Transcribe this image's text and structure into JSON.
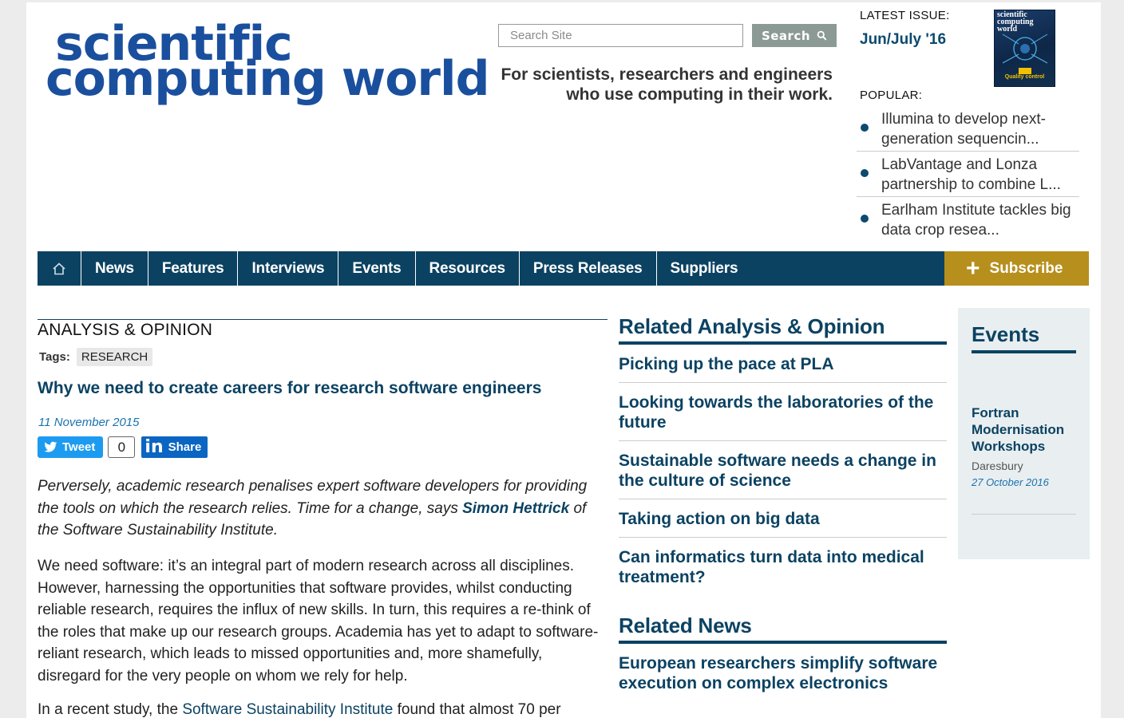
{
  "logo": {
    "line1": "scientific",
    "line2": "computing world"
  },
  "search": {
    "placeholder": "Search Site",
    "button_label": "Search"
  },
  "tagline": {
    "line1": "For scientists, researchers and engineers",
    "line2": "who use computing in their work."
  },
  "latest_issue": {
    "label": "LATEST ISSUE:",
    "issue": "Jun/July '16",
    "cover_title": "scientific computing world",
    "cover_caption": "Quality control"
  },
  "popular": {
    "label": "POPULAR:",
    "items": [
      {
        "text": "Illumina to develop next-generation sequencin..."
      },
      {
        "text": "LabVantage and Lonza partnership to combine L..."
      },
      {
        "text": "Earlham Institute tackles big data crop resea..."
      }
    ]
  },
  "nav": {
    "items": [
      "News",
      "Features",
      "Interviews",
      "Events",
      "Resources",
      "Press Releases",
      "Suppliers"
    ],
    "subscribe_label": "Subscribe"
  },
  "article": {
    "section": "ANALYSIS & OPINION",
    "tags_label": "Tags:",
    "tag": "RESEARCH",
    "title": "Why we need to create careers for research software engineers",
    "date": "11 November 2015",
    "tweet_label": "Tweet",
    "tweet_count": "0",
    "linkedin_label": "Share",
    "standfirst_pre": "Perversely, academic research penalises expert software developers for providing the tools on which the research relies. Time for a change, says ",
    "standfirst_author": "Simon Hettrick",
    "standfirst_post": " of the Software Sustainability Institute.",
    "paragraph1": "We need software: it’s an integral part of modern research across all disciplines. However, harnessing the opportunities that software provides, whilst conducting reliable research, requires the influx of new skills. In turn, this requires a re-think of the roles that make up our research groups. Academia has yet to adapt to software-reliant research, which leads to missed opportunities and, more shamefully, disregard for the very people on whom we rely for help.",
    "paragraph2_pre": "In a recent study, the ",
    "paragraph2_link": "Software Sustainability Institute",
    "paragraph2_post": " found that almost 70 per"
  },
  "related_analysis": {
    "heading": "Related Analysis & Opinion",
    "items": [
      "Picking up the pace at PLA",
      "Looking towards the laboratories of the future",
      "Sustainable software needs a change in the culture of science",
      "Taking action on big data",
      "Can informatics turn data into medical treatment?"
    ]
  },
  "related_news": {
    "heading": "Related News",
    "items": [
      "European researchers simplify software execution on complex electronics"
    ]
  },
  "events": {
    "heading": "Events",
    "item": {
      "title": "Fortran Modernisation Workshops",
      "place": "Daresbury",
      "date": "27 October 2016"
    }
  },
  "colors": {
    "navy": "#0b4262",
    "logo_blue": "#1a4f9e",
    "subscribe_gold": "#b78f1c",
    "link_blue": "#1a73b0"
  }
}
